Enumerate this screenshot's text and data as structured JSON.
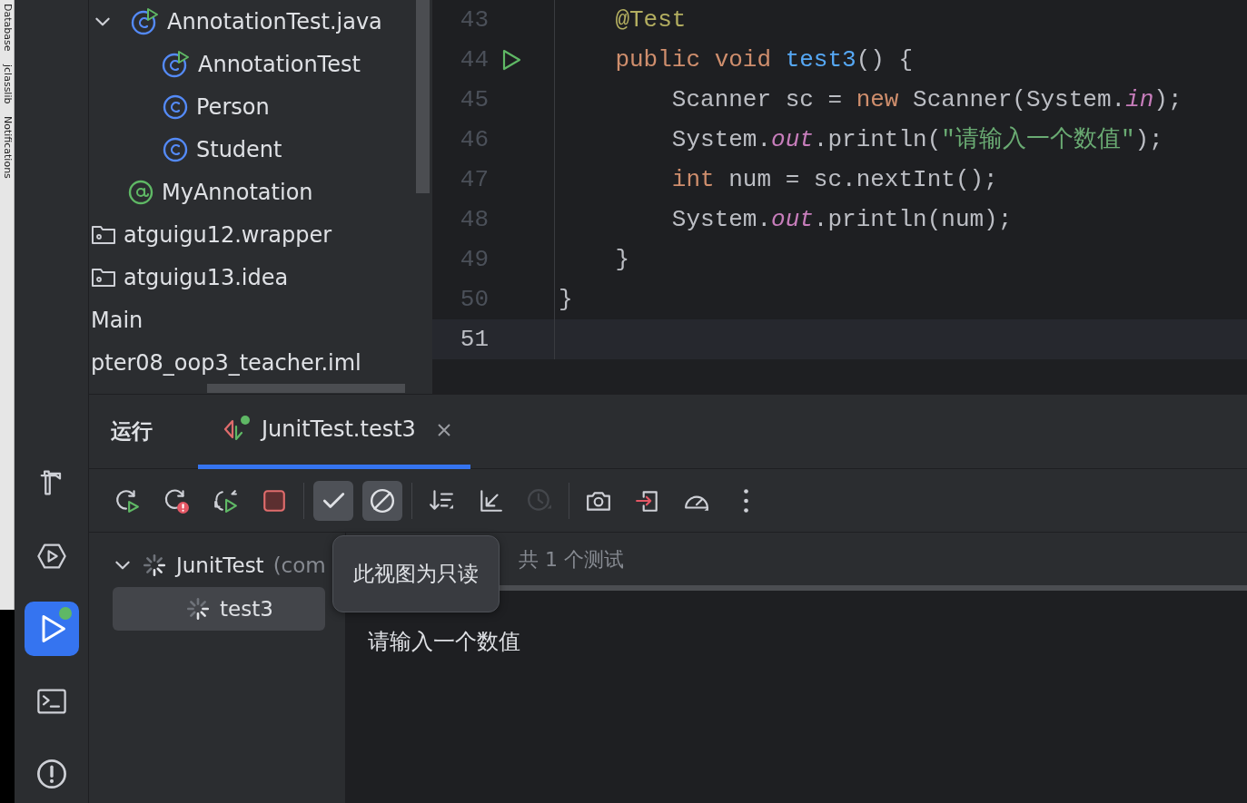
{
  "side_strip": {
    "labels": [
      "Database",
      "jclasslib",
      "Notifications"
    ]
  },
  "tool_window_bar": {
    "items": [
      {
        "kind": "build",
        "selected": false,
        "running": false
      },
      {
        "kind": "services",
        "selected": false,
        "running": false
      },
      {
        "kind": "run",
        "selected": true,
        "running": true
      },
      {
        "kind": "terminal",
        "selected": false,
        "running": false
      },
      {
        "kind": "problems",
        "selected": false,
        "running": false
      }
    ]
  },
  "project_tree": {
    "items": [
      {
        "label": "AnnotationTest.java",
        "kind": "test-class",
        "expanded": true,
        "children": [
          {
            "label": "AnnotationTest",
            "kind": "test-class"
          },
          {
            "label": "Person",
            "kind": "class"
          },
          {
            "label": "Student",
            "kind": "class"
          }
        ]
      },
      {
        "label": "MyAnnotation",
        "kind": "annotation"
      },
      {
        "label": "atguigu12.wrapper",
        "kind": "folder"
      },
      {
        "label": "atguigu13.idea",
        "kind": "folder"
      },
      {
        "label": "Main",
        "kind": "file"
      },
      {
        "label": "pter08_oop3_teacher.iml",
        "kind": "file"
      }
    ]
  },
  "editor": {
    "lines": [
      {
        "number": "43",
        "gutter_run": false,
        "current": false,
        "tokens": [
          {
            "text": "    @Test",
            "kind": "annotation"
          }
        ]
      },
      {
        "number": "44",
        "gutter_run": true,
        "current": false,
        "tokens": [
          {
            "text": "    public void ",
            "kind": "keyword"
          },
          {
            "text": "test3",
            "kind": "method"
          },
          {
            "text": "() {",
            "kind": "plain"
          }
        ]
      },
      {
        "number": "45",
        "gutter_run": false,
        "current": false,
        "tokens": [
          {
            "text": "        Scanner sc = ",
            "kind": "plain"
          },
          {
            "text": "new ",
            "kind": "keyword"
          },
          {
            "text": "Scanner(System.",
            "kind": "plain"
          },
          {
            "text": "in",
            "kind": "static"
          },
          {
            "text": ");",
            "kind": "plain"
          }
        ]
      },
      {
        "number": "46",
        "gutter_run": false,
        "current": false,
        "tokens": [
          {
            "text": "        System.",
            "kind": "plain"
          },
          {
            "text": "out",
            "kind": "static"
          },
          {
            "text": ".println(",
            "kind": "plain"
          },
          {
            "text": "\"请输入一个数值\"",
            "kind": "string"
          },
          {
            "text": ");",
            "kind": "plain"
          }
        ]
      },
      {
        "number": "47",
        "gutter_run": false,
        "current": false,
        "tokens": [
          {
            "text": "        int ",
            "kind": "keyword"
          },
          {
            "text": "num = sc.nextInt();",
            "kind": "plain"
          }
        ]
      },
      {
        "number": "48",
        "gutter_run": false,
        "current": false,
        "tokens": [
          {
            "text": "        System.",
            "kind": "plain"
          },
          {
            "text": "out",
            "kind": "static"
          },
          {
            "text": ".println(num);",
            "kind": "plain"
          }
        ]
      },
      {
        "number": "49",
        "gutter_run": false,
        "current": false,
        "tokens": [
          {
            "text": "    }",
            "kind": "plain"
          }
        ]
      },
      {
        "number": "50",
        "gutter_run": false,
        "current": false,
        "tokens": [
          {
            "text": "}",
            "kind": "plain"
          }
        ]
      },
      {
        "number": "51",
        "gutter_run": false,
        "current": true
      }
    ]
  },
  "run_panel": {
    "title": "运行",
    "tabs": [
      {
        "label": "JunitTest.test3",
        "selected": true
      }
    ],
    "toolbar": [
      {
        "kind": "rerun",
        "disabled": false
      },
      {
        "kind": "rerun-failed",
        "disabled": false
      },
      {
        "kind": "auto-rerun",
        "disabled": false
      },
      {
        "kind": "stop",
        "disabled": false
      },
      {
        "kind": "separator"
      },
      {
        "kind": "show-passed",
        "disabled": false,
        "selected": true
      },
      {
        "kind": "show-ignored",
        "disabled": false,
        "selected": true
      },
      {
        "kind": "separator"
      },
      {
        "kind": "sort",
        "disabled": false
      },
      {
        "kind": "import",
        "disabled": false
      },
      {
        "kind": "history",
        "disabled": true
      },
      {
        "kind": "separator"
      },
      {
        "kind": "screenshot",
        "disabled": false
      },
      {
        "kind": "export",
        "disabled": false
      },
      {
        "kind": "coverage",
        "disabled": false
      },
      {
        "kind": "more",
        "disabled": false
      }
    ],
    "test_tree": [
      {
        "label": "JunitTest",
        "suffix": "(com",
        "expanded": true,
        "running": true,
        "selected": false,
        "children": [
          {
            "label": "test3",
            "running": true,
            "selected": true
          }
        ]
      }
    ],
    "status": "共 1 个测试",
    "console": [
      "请输入一个数值"
    ],
    "tooltip": "此视图为只读"
  }
}
